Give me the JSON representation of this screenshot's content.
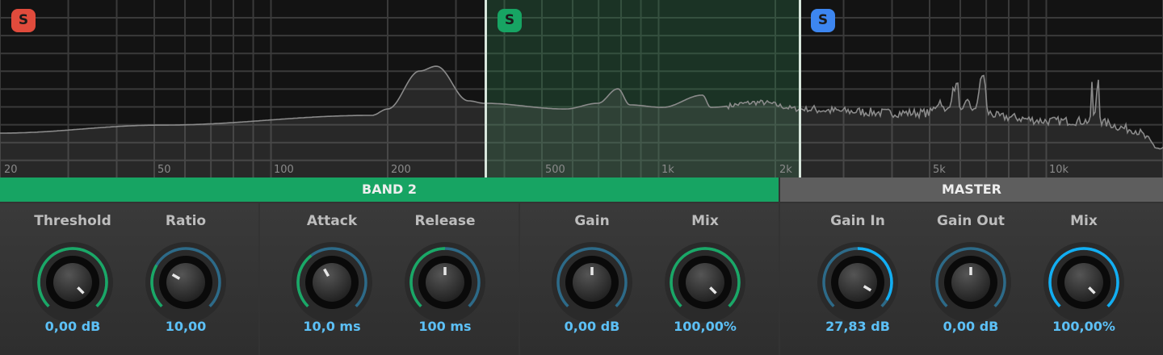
{
  "bands": [
    {
      "solo_label": "S",
      "color": "#e04b3c"
    },
    {
      "solo_label": "S",
      "color": "#17a463"
    },
    {
      "solo_label": "S",
      "color": "#3d86f0"
    }
  ],
  "freq_ticks": [
    "20",
    "50",
    "100",
    "200",
    "500",
    "1k",
    "2k",
    "5k",
    "10k"
  ],
  "freq_tick_values": [
    20,
    50,
    100,
    200,
    500,
    1000,
    2000,
    5000,
    10000
  ],
  "spectrum": [
    [
      20,
      -75
    ],
    [
      52,
      -70.5
    ],
    [
      182,
      -65
    ],
    [
      200,
      -61.4
    ],
    [
      242,
      -40
    ],
    [
      267,
      -37.3
    ],
    [
      323,
      -56.8
    ],
    [
      356,
      -58.2
    ],
    [
      574,
      -61.4
    ],
    [
      697,
      -58.2
    ],
    [
      785,
      -50
    ],
    [
      843,
      -59.1
    ],
    [
      1022,
      -60.5
    ],
    [
      1298,
      -53.6
    ],
    [
      1362,
      -60.5
    ],
    [
      1818,
      -57.7
    ],
    [
      2310,
      -61.4
    ],
    [
      3080,
      -62.7
    ],
    [
      3914,
      -63.6
    ],
    [
      4980,
      -63.6
    ],
    [
      5350,
      -56.8
    ],
    [
      5470,
      -63.6
    ],
    [
      5890,
      -47.7
    ],
    [
      6030,
      -63.6
    ],
    [
      6320,
      -56.8
    ],
    [
      6470,
      -63.6
    ],
    [
      6900,
      -41.8
    ],
    [
      7060,
      -63.6
    ],
    [
      7660,
      -65.9
    ],
    [
      10220,
      -68.2
    ],
    [
      12980,
      -68.2
    ],
    [
      13100,
      -45.5
    ],
    [
      13280,
      -68.2
    ],
    [
      13620,
      -44.5
    ],
    [
      13820,
      -69.1
    ],
    [
      16520,
      -72.7
    ],
    [
      20000,
      -84.1
    ]
  ],
  "band_header": "BAND 2",
  "master_header": "MASTER",
  "colors": {
    "green": "#17a463",
    "track": "#2d6a88",
    "blue": "#12aef2"
  },
  "knobs": [
    {
      "label": "Threshold",
      "value": "0,00 dB",
      "pos": 1.0,
      "fill": [
        0,
        1
      ],
      "color": "#1aa866"
    },
    {
      "label": "Ratio",
      "value": "10,00",
      "pos": 0.28,
      "fill": [
        0,
        0.28
      ],
      "color": "#1aa866"
    },
    {
      "label": "Attack",
      "value": "10,0 ms",
      "pos": 0.39,
      "fill": [
        0,
        0.36
      ],
      "color": "#1aa866"
    },
    {
      "label": "Release",
      "value": "100 ms",
      "pos": 0.5,
      "fill": [
        0,
        0.5
      ],
      "color": "#1aa866"
    },
    {
      "label": "Gain",
      "value": "0,00 dB",
      "pos": 0.5,
      "fill": [
        0.5,
        0.5
      ],
      "color": "#1aa866"
    },
    {
      "label": "Mix",
      "value": "100,00%",
      "pos": 1.0,
      "fill": [
        0,
        1
      ],
      "color": "#1aa866"
    },
    {
      "label": "Gain In",
      "value": "27,83 dB",
      "pos": 0.95,
      "fill": [
        0.5,
        0.95
      ],
      "color": "#12aef2"
    },
    {
      "label": "Gain Out",
      "value": "0,00 dB",
      "pos": 0.5,
      "fill": [
        0.5,
        0.5
      ],
      "color": "#12aef2"
    },
    {
      "label": "Mix",
      "value": "100,00%",
      "pos": 1.0,
      "fill": [
        0,
        1
      ],
      "color": "#12aef2"
    }
  ]
}
